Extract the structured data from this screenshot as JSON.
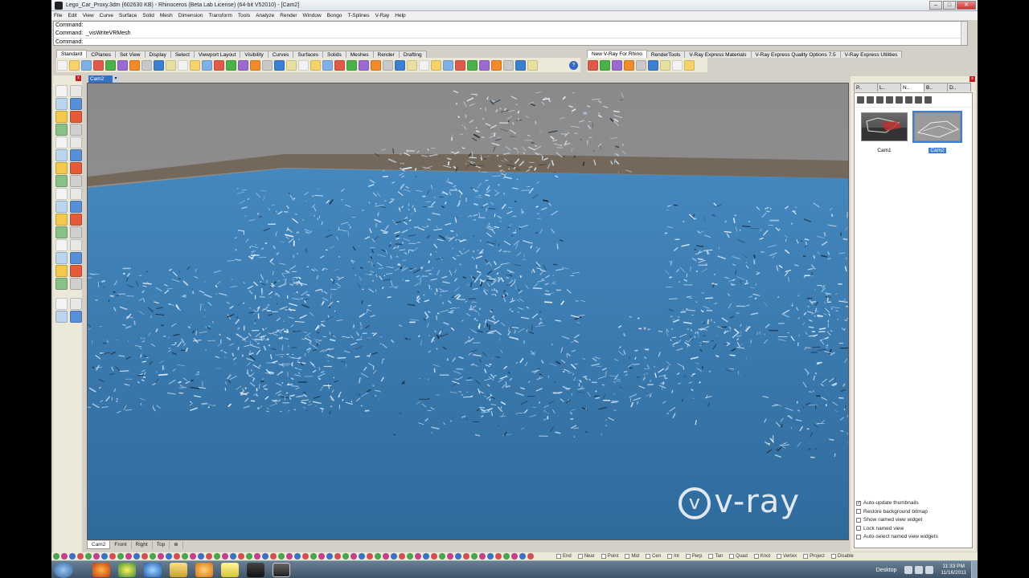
{
  "window": {
    "title": "Lego_Car_Proxy.3dm (602630 KB) - Rhinoceros (Beta Lab License) (64-bit V52010) - [Cam2]",
    "minimize": "–",
    "maximize": "□",
    "close": "✕"
  },
  "menu": [
    "File",
    "Edit",
    "View",
    "Curve",
    "Surface",
    "Solid",
    "Mesh",
    "Dimension",
    "Transform",
    "Tools",
    "Analyze",
    "Render",
    "Window",
    "Bongo",
    "T-Splines",
    "V-Ray",
    "Help"
  ],
  "command": {
    "history": [
      {
        "label": "Command:",
        "text": ""
      },
      {
        "label": "Command:",
        "text": "_visWriteVRMesh"
      }
    ],
    "prompt_label": "Command:",
    "value": ""
  },
  "toolbar_tabs_left": [
    "Standard",
    "CPlanes",
    "Set View",
    "Display",
    "Select",
    "Viewport Layout",
    "Visibility",
    "Curves",
    "Surfaces",
    "Solids",
    "Meshes",
    "Render",
    "Drafting"
  ],
  "toolbar_tabs_right": [
    "New V-Ray For Rhino",
    "RenderTools",
    "V-Ray Express Materials",
    "V-Ray Express Quality Options 7.5",
    "V-Ray Express Utilities"
  ],
  "viewport": {
    "active_tab": "Cam2",
    "dropdown_arrow": "▾",
    "bottom_tabs": [
      "Cam2",
      "Front",
      "Right",
      "Top"
    ],
    "add_tab": "⊕",
    "watermark": "v-ray",
    "logo_glyph": "v"
  },
  "right_panel": {
    "tabs": [
      "P..",
      "L..",
      "N..",
      "B..",
      "D.."
    ],
    "views": [
      {
        "name": "Cam1",
        "selected": false
      },
      {
        "name": "Cam2",
        "selected": true
      }
    ],
    "options": [
      {
        "label": "Auto-update thumbnails",
        "checked": true
      },
      {
        "label": "Restore background bitmap",
        "checked": false
      },
      {
        "label": "Show named view widget",
        "checked": false
      },
      {
        "label": "Lock named view",
        "checked": false
      },
      {
        "label": "Auto-select named view widgets",
        "checked": false
      }
    ]
  },
  "status": {
    "snaps": [
      "End",
      "Near",
      "Point",
      "Mid",
      "Cen",
      "Int",
      "Perp",
      "Tan",
      "Quad",
      "Knot",
      "Vertex",
      "Project",
      "Disable"
    ]
  },
  "taskbar": {
    "desktop_label": "Desktop",
    "time": "11:33 PM",
    "date": "11/16/2011"
  },
  "colors": {
    "viewport_ground": "#3a73a8",
    "viewport_bg": "#8e8e8e",
    "accent": "#3d7fd8"
  }
}
